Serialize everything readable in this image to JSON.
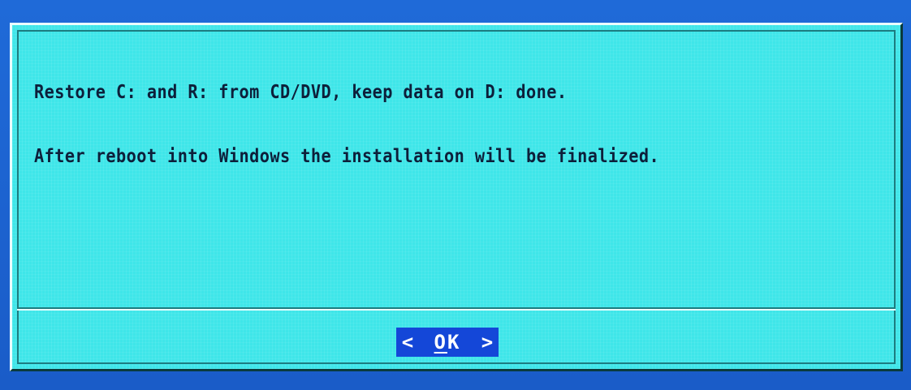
{
  "dialog": {
    "line1": "Restore C: and R: from CD/DVD, keep data on D: done.",
    "line2": "After reboot into Windows the installation will be finalized."
  },
  "button": {
    "left": "<",
    "hotkey": "O",
    "rest": "K",
    "right": ">"
  },
  "colors": {
    "background": "#1d63d0",
    "dialog": "#3fe6e9",
    "text": "#0d1f3a",
    "button": "#1447d8",
    "button_text": "#ffffff"
  }
}
